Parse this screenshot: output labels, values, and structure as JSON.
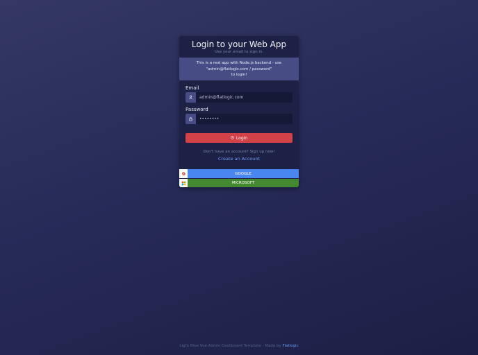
{
  "login": {
    "title": "Login to your Web App",
    "subtitle": "Use your email to sign in.",
    "info_line1": "This is a real app with Node.js backend - use",
    "info_line2": "\"admin@flatlogic.com / password\"",
    "info_line3": "to login!",
    "email_label": "Email",
    "email_value": "admin@flatlogic.com",
    "password_label": "Password",
    "password_value": "password",
    "login_button": "Login",
    "signup_text": "Don't have an account? Sign up now!",
    "create_account": "Create an Account",
    "google_label": "GOOGLE",
    "microsoft_label": "MICROSOFT"
  },
  "footer": {
    "text": "Light Blue Vue Admin Dashboard Template - Made by",
    "brand": "Flatlogic"
  },
  "icons": {
    "email": "user-icon",
    "password": "lock-icon",
    "login": "login-icon",
    "google": "google-icon",
    "microsoft": "microsoft-icon"
  },
  "colors": {
    "accent_red": "#d24147",
    "google_blue": "#4a86f0",
    "microsoft_green": "#44882f",
    "link_blue": "#6f9cf7"
  }
}
